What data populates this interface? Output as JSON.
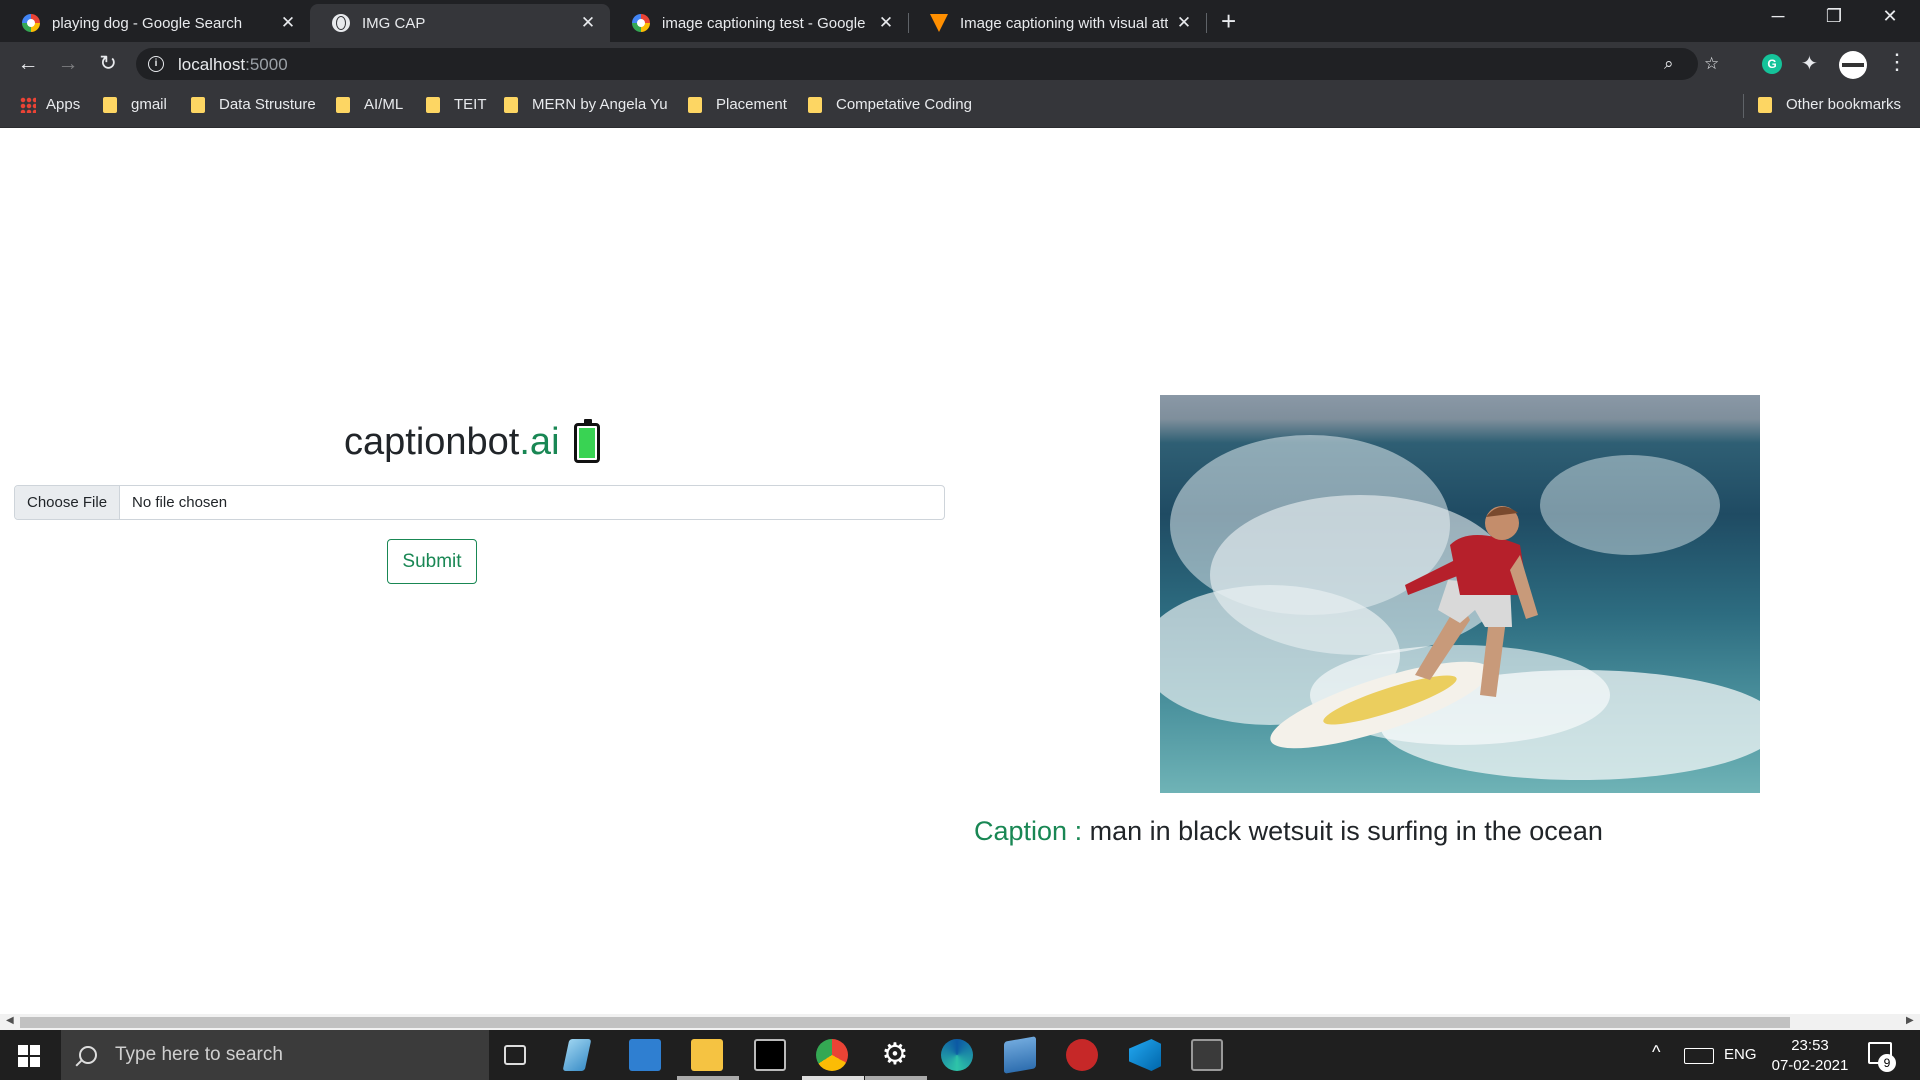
{
  "browser": {
    "tabs": [
      {
        "title": "playing dog - Google Search",
        "icon": "google-icon",
        "active": false
      },
      {
        "title": "IMG CAP",
        "icon": "globe-icon",
        "active": true
      },
      {
        "title": "image captioning test - Google S",
        "icon": "google-icon",
        "active": false
      },
      {
        "title": "Image captioning with visual atte",
        "icon": "tensorflow-icon",
        "active": false
      }
    ],
    "new_tab": "+",
    "window_controls": {
      "minimize": "─",
      "restore": "❐",
      "close": "✕"
    },
    "address": {
      "host": "localhost",
      "port": ":5000"
    },
    "bookmarks": [
      "Apps",
      "gmail",
      "Data Strusture",
      "AI/ML",
      "TEIT",
      "MERN by Angela Yu",
      "Placement",
      "Competative Coding"
    ],
    "other_bookmarks": "Other bookmarks"
  },
  "page": {
    "brand": {
      "name": "captionbot",
      "suffix": ".ai",
      "emoji": "battery-icon"
    },
    "file_input": {
      "button": "Choose File",
      "status": "No file chosen"
    },
    "submit_label": "Submit",
    "caption": {
      "label": "Caption :",
      "text": "man in black wetsuit is surfing in the ocean"
    }
  },
  "taskbar": {
    "search_placeholder": "Type here to search",
    "language": "ENG",
    "time": "23:53",
    "date": "07-02-2021",
    "notification_count": "9"
  },
  "colors": {
    "accent_green": "#198754",
    "tab_bg": "#202124",
    "toolbar_bg": "#35363a"
  }
}
